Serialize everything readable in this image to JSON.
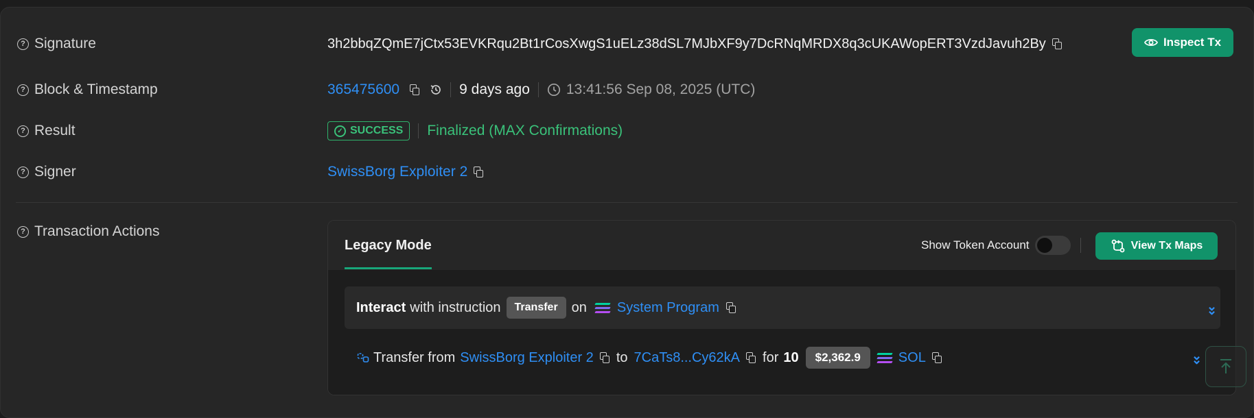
{
  "signature": {
    "label": "Signature",
    "value": "3h2bbqZQmE7jCtx53EVKRqu2Bt1rCosXwgS1uELz38dSL7MJbXF9y7DcRNqMRDX8q3cUKAWopERT3VzdJavuh2By",
    "inspect_label": "Inspect Tx"
  },
  "block": {
    "label": "Block & Timestamp",
    "number": "365475600",
    "relative": "9 days ago",
    "timestamp": "13:41:56 Sep 08, 2025 (UTC)"
  },
  "result": {
    "label": "Result",
    "status": "SUCCESS",
    "confirmation": "Finalized (MAX Confirmations)"
  },
  "signer": {
    "label": "Signer",
    "name": "SwissBorg Exploiter 2"
  },
  "actions": {
    "label": "Transaction Actions",
    "tab": "Legacy Mode",
    "show_token_account": "Show Token Account",
    "view_maps": "View Tx Maps",
    "instruction": {
      "interact": "Interact",
      "with_instruction": "with instruction",
      "type": "Transfer",
      "on": "on",
      "program": "System Program"
    },
    "transfer": {
      "prefix": "Transfer from",
      "from": "SwissBorg Exploiter 2",
      "to_word": "to",
      "to": "7CaTs8...Cy62kA",
      "for_word": "for",
      "amount": "10",
      "usd": "$2,362.9",
      "token": "SOL"
    }
  },
  "colors": {
    "accent": "#11936a",
    "link": "#2f8ff5",
    "success": "#3ac27a"
  }
}
